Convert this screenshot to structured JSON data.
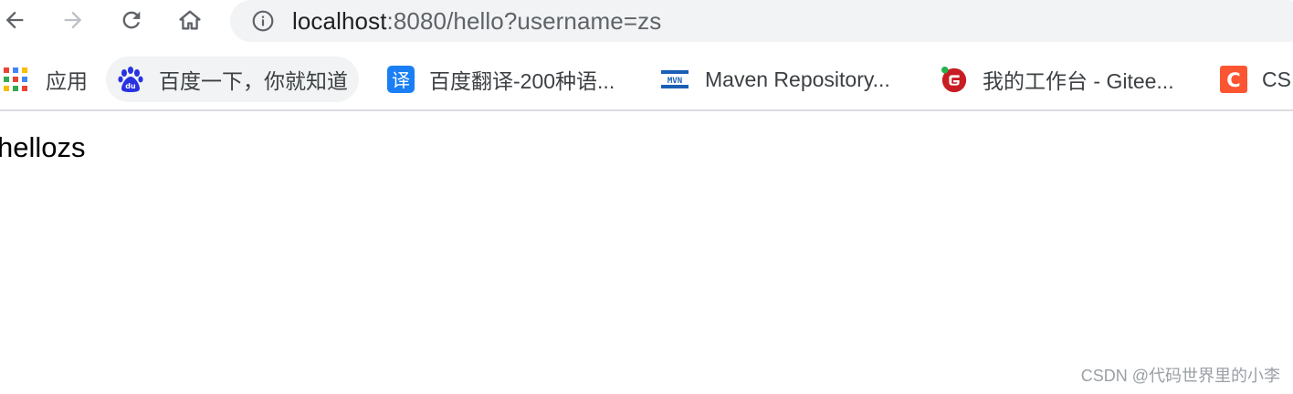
{
  "toolbar": {
    "back_icon": "arrow-left-icon",
    "forward_icon": "arrow-right-icon",
    "reload_icon": "reload-icon",
    "home_icon": "home-icon"
  },
  "omnibox": {
    "info_icon": "info-icon",
    "url_host": "localhost",
    "url_rest": ":8080/hello?username=zs"
  },
  "bookmarks": {
    "items": [
      {
        "label": "应用",
        "icon": "apps-grid-icon"
      },
      {
        "label": "百度一下，你就知道",
        "icon": "baidu-paw-icon"
      },
      {
        "label": "百度翻译-200种语...",
        "icon": "translate-icon"
      },
      {
        "label": "Maven Repository...",
        "icon": "mvn-icon"
      },
      {
        "label": "我的工作台 - Gitee...",
        "icon": "gitee-icon"
      },
      {
        "label": "CS",
        "icon": "csdn-icon"
      }
    ]
  },
  "page": {
    "body_text": "hellozs"
  },
  "watermark": "CSDN @代码世界里的小李",
  "colors": {
    "omnibox_bg": "#f1f3f4",
    "divider": "#dadce0",
    "baidu": "#2932e1",
    "translate": "#1a7ff5",
    "mvn": "#1a5fb4",
    "gitee": "#c71d23",
    "csdn": "#fc5531"
  }
}
